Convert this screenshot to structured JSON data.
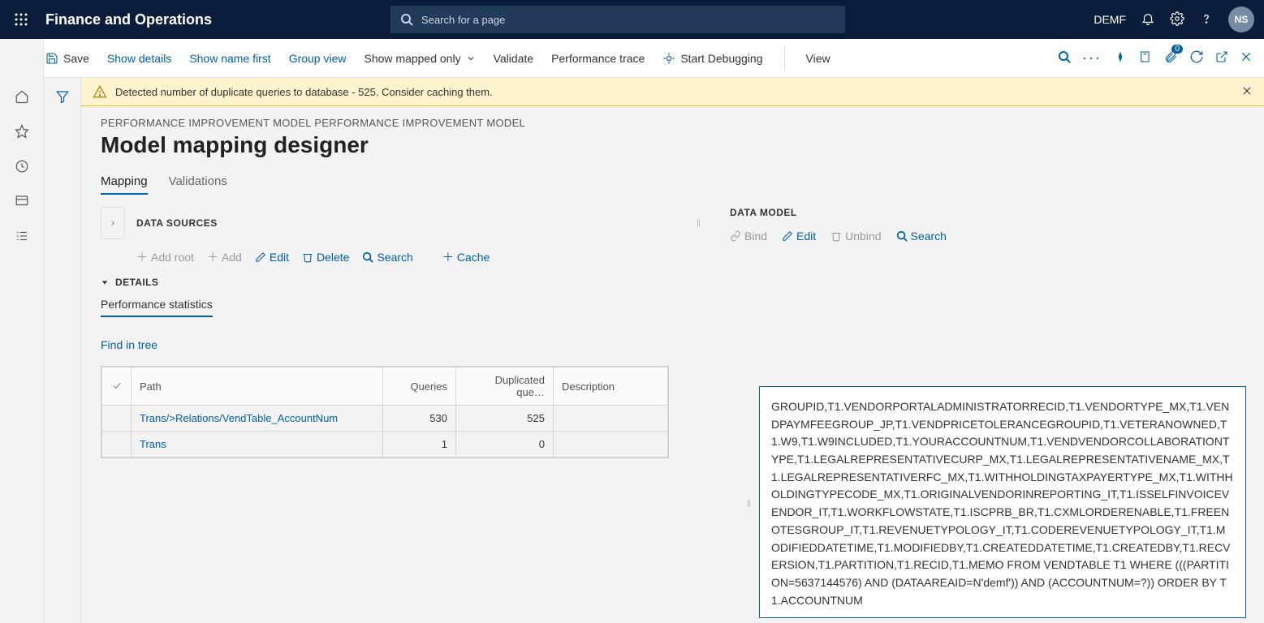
{
  "topnav": {
    "brand": "Finance and Operations",
    "search_placeholder": "Search for a page",
    "company": "DEMF",
    "avatar_initials": "NS"
  },
  "actionbar": {
    "save": "Save",
    "show_details": "Show details",
    "show_name_first": "Show name first",
    "group_view": "Group view",
    "show_mapped_only": "Show mapped only",
    "validate": "Validate",
    "performance_trace": "Performance trace",
    "start_debugging": "Start Debugging",
    "view": "View",
    "attachment_badge": "0"
  },
  "warning": "Detected number of duplicate queries to database - 525. Consider caching them.",
  "breadcrumb": "PERFORMANCE IMPROVEMENT MODEL PERFORMANCE IMPROVEMENT MODEL",
  "page_title": "Model mapping designer",
  "tabs": {
    "mapping": "Mapping",
    "validations": "Validations"
  },
  "data_sources": {
    "title": "DATA SOURCES",
    "add_root": "Add root",
    "add": "Add",
    "edit": "Edit",
    "delete": "Delete",
    "search": "Search",
    "cache": "Cache"
  },
  "details": {
    "title": "DETAILS",
    "performance_statistics": "Performance statistics",
    "find_in_tree": "Find in tree"
  },
  "grid": {
    "headers": {
      "path": "Path",
      "queries": "Queries",
      "duplicated": "Duplicated que…",
      "description": "Description"
    },
    "rows": [
      {
        "path": "Trans/>Relations/VendTable_AccountNum",
        "queries": "530",
        "dup": "525",
        "desc": ""
      },
      {
        "path": "Trans",
        "queries": "1",
        "dup": "0",
        "desc": ""
      }
    ]
  },
  "data_model": {
    "title": "DATA MODEL",
    "bind": "Bind",
    "edit": "Edit",
    "unbind": "Unbind",
    "search": "Search"
  },
  "sql_text": "GROUPID,T1.VENDORPORTALADMINISTRATORRECID,T1.VENDORTYPE_MX,T1.VENDPAYMFEEGROUP_JP,T1.VENDPRICETOLERANCEGROUPID,T1.VETERANOWNED,T1.W9,T1.W9INCLUDED,T1.YOURACCOUNTNUM,T1.VENDVENDORCOLLABORATIONTYPE,T1.LEGALREPRESENTATIVECURP_MX,T1.LEGALREPRESENTATIVENAME_MX,T1.LEGALREPRESENTATIVERFC_MX,T1.WITHHOLDINGTAXPAYERTYPE_MX,T1.WITHHOLDINGTYPECODE_MX,T1.ORIGINALVENDORINREPORTING_IT,T1.ISSELFINVOICEVENDOR_IT,T1.WORKFLOWSTATE,T1.ISCPRB_BR,T1.CXMLORDERENABLE,T1.FREENOTESGROUP_IT,T1.REVENUETYPOLOGY_IT,T1.CODEREVENUETYPOLOGY_IT,T1.MODIFIEDDATETIME,T1.MODIFIEDBY,T1.CREATEDDATETIME,T1.CREATEDBY,T1.RECVERSION,T1.PARTITION,T1.RECID,T1.MEMO FROM VENDTABLE T1 WHERE (((PARTITION=5637144576) AND (DATAAREAID=N'demf')) AND (ACCOUNTNUM=?)) ORDER BY T1.ACCOUNTNUM"
}
